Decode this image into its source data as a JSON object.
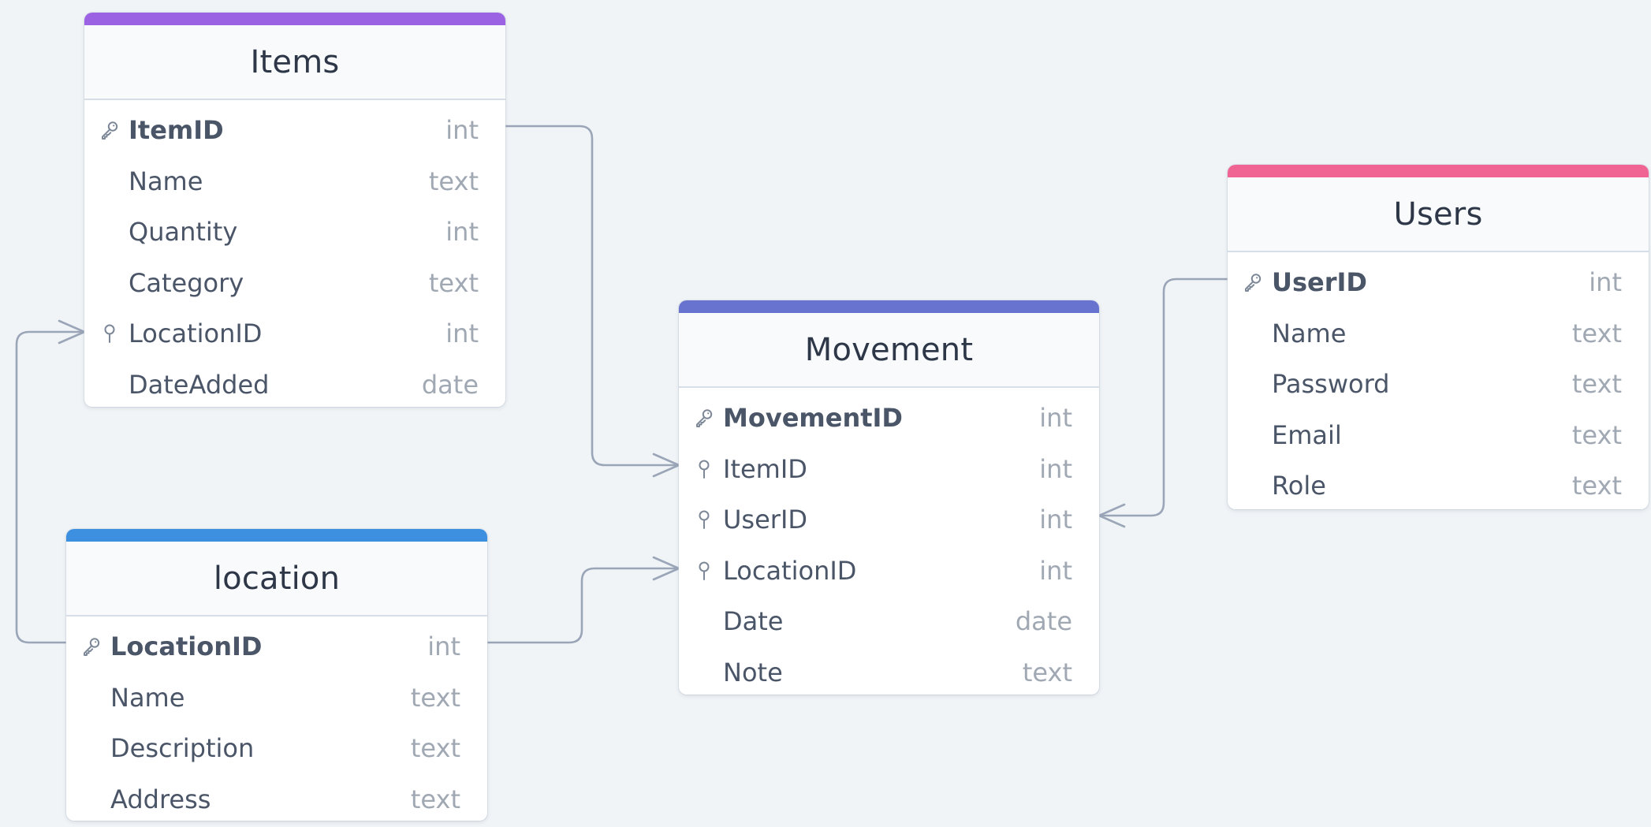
{
  "colors": {
    "background": "#f0f4f7",
    "connector": "#9aa6b8",
    "items_accent": "#9c62e4",
    "movement_accent": "#6773cf",
    "users_accent": "#ef6492",
    "location_accent": "#3d8fdf"
  },
  "tables": {
    "items": {
      "title": "Items",
      "fields": [
        {
          "name": "ItemID",
          "type": "int",
          "icon": "key-icon"
        },
        {
          "name": "Name",
          "type": "text",
          "icon": ""
        },
        {
          "name": "Quantity",
          "type": "int",
          "icon": ""
        },
        {
          "name": "Category",
          "type": "text",
          "icon": ""
        },
        {
          "name": "LocationID",
          "type": "int",
          "icon": "foreign-key-icon"
        },
        {
          "name": "DateAdded",
          "type": "date",
          "icon": ""
        }
      ]
    },
    "location": {
      "title": "location",
      "fields": [
        {
          "name": "LocationID",
          "type": "int",
          "icon": "key-icon"
        },
        {
          "name": "Name",
          "type": "text",
          "icon": ""
        },
        {
          "name": "Description",
          "type": "text",
          "icon": ""
        },
        {
          "name": "Address",
          "type": "text",
          "icon": ""
        }
      ]
    },
    "movement": {
      "title": "Movement",
      "fields": [
        {
          "name": "MovementID",
          "type": "int",
          "icon": "key-icon"
        },
        {
          "name": "ItemID",
          "type": "int",
          "icon": "foreign-key-icon"
        },
        {
          "name": "UserID",
          "type": "int",
          "icon": "foreign-key-icon"
        },
        {
          "name": "LocationID",
          "type": "int",
          "icon": "foreign-key-icon"
        },
        {
          "name": "Date",
          "type": "date",
          "icon": ""
        },
        {
          "name": "Note",
          "type": "text",
          "icon": ""
        }
      ]
    },
    "users": {
      "title": "Users",
      "fields": [
        {
          "name": "UserID",
          "type": "int",
          "icon": "key-icon"
        },
        {
          "name": "Name",
          "type": "text",
          "icon": ""
        },
        {
          "name": "Password",
          "type": "text",
          "icon": ""
        },
        {
          "name": "Email",
          "type": "text",
          "icon": ""
        },
        {
          "name": "Role",
          "type": "text",
          "icon": ""
        }
      ]
    }
  },
  "relationships": [
    {
      "from": "Items.ItemID",
      "to": "Movement.ItemID",
      "cardinality": "one-to-many"
    },
    {
      "from": "location.LocationID",
      "to": "Items.LocationID",
      "cardinality": "one-to-many"
    },
    {
      "from": "location.LocationID",
      "to": "Movement.LocationID",
      "cardinality": "one-to-many"
    },
    {
      "from": "Users.UserID",
      "to": "Movement.UserID",
      "cardinality": "one-to-many"
    }
  ]
}
